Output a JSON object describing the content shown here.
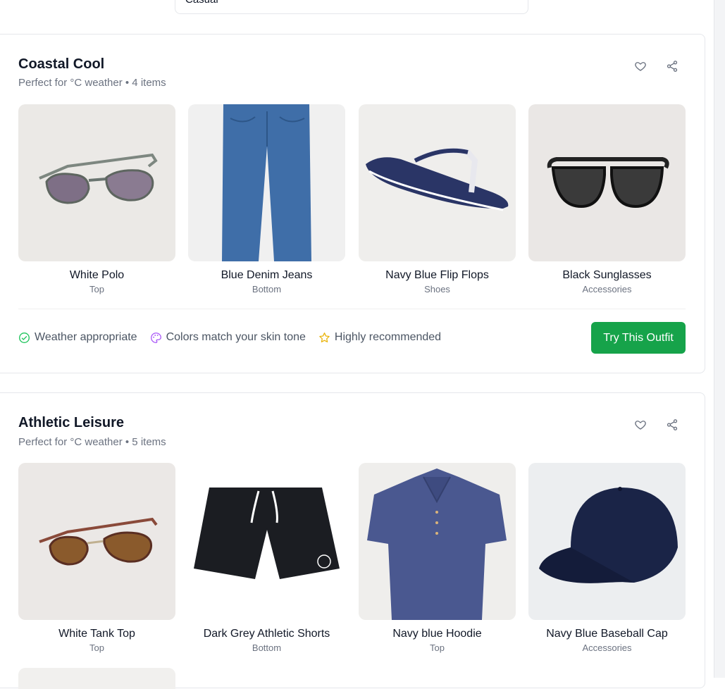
{
  "filter": {
    "occasion_value": "Casual"
  },
  "outfits": [
    {
      "title": "Coastal Cool",
      "subtitle": "Perfect for °C weather • 4 items",
      "items": [
        {
          "name": "White Polo",
          "category": "Top"
        },
        {
          "name": "Blue Denim Jeans",
          "category": "Bottom"
        },
        {
          "name": "Navy Blue Flip Flops",
          "category": "Shoes"
        },
        {
          "name": "Black Sunglasses",
          "category": "Accessories"
        }
      ],
      "badges": {
        "weather": "Weather appropriate",
        "colors": "Colors match your skin tone",
        "recommended": "Highly recommended"
      },
      "cta": "Try This Outfit"
    },
    {
      "title": "Athletic Leisure",
      "subtitle": "Perfect for °C weather • 5 items",
      "items": [
        {
          "name": "White Tank Top",
          "category": "Top"
        },
        {
          "name": "Dark Grey Athletic Shorts",
          "category": "Bottom"
        },
        {
          "name": "Navy blue Hoodie",
          "category": "Top"
        },
        {
          "name": "Navy Blue Baseball Cap",
          "category": "Accessories"
        }
      ]
    }
  ],
  "colors": {
    "accent_green": "#16a34a",
    "check_green": "#22c55e",
    "palette_purple": "#a855f7",
    "star_gold": "#eab308"
  },
  "icons": [
    "heart-icon",
    "share-icon",
    "check-circle-icon",
    "palette-icon",
    "star-icon",
    "chevron-down-icon"
  ]
}
